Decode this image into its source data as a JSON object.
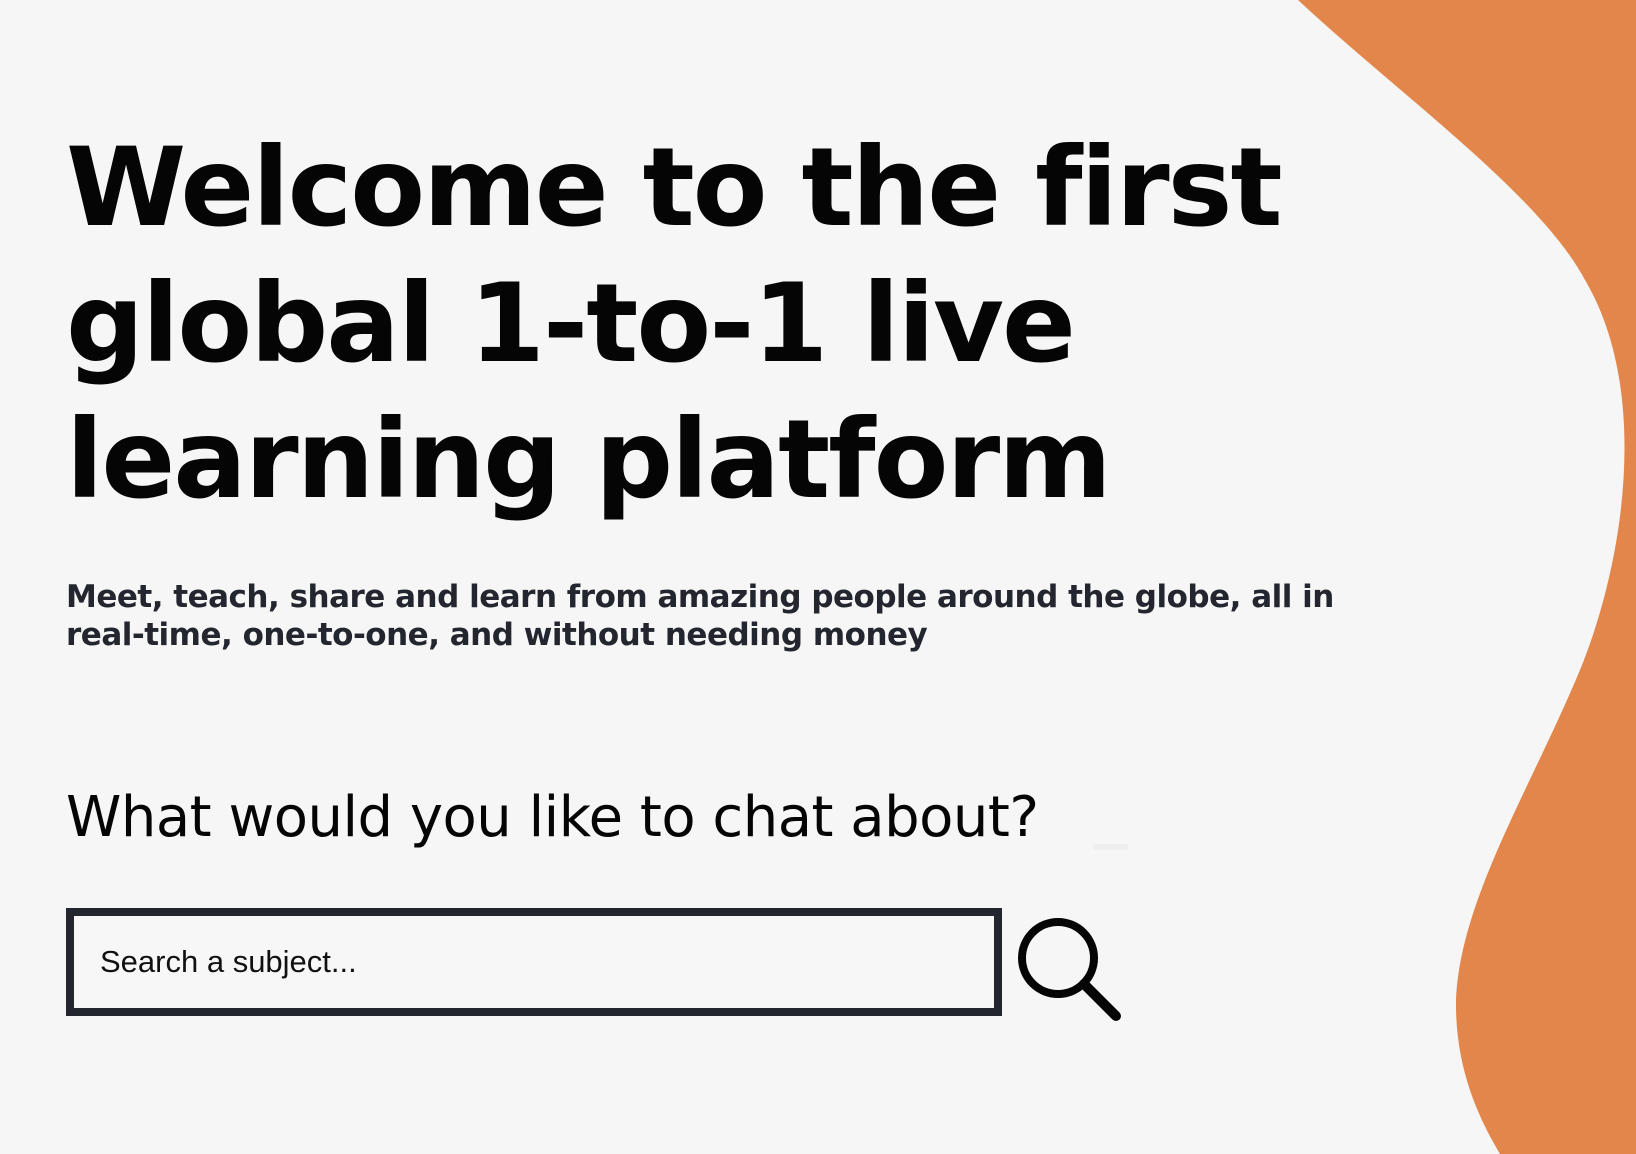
{
  "colors": {
    "background": "#f6f6f6",
    "accent_blob": "#e2864b",
    "input_border": "#23262e",
    "text": "#050505",
    "tagline_text": "#23262e"
  },
  "hero": {
    "headline": "Welcome to the first global 1-to-1 live learning platform",
    "tagline": "Meet, teach, share and learn from amazing people around the globe, all in real-time, one-to-one, and without needing money"
  },
  "search": {
    "prompt": "What would you like to chat about?",
    "placeholder": "Search a subject...",
    "value": "",
    "button_icon": "search-icon"
  }
}
